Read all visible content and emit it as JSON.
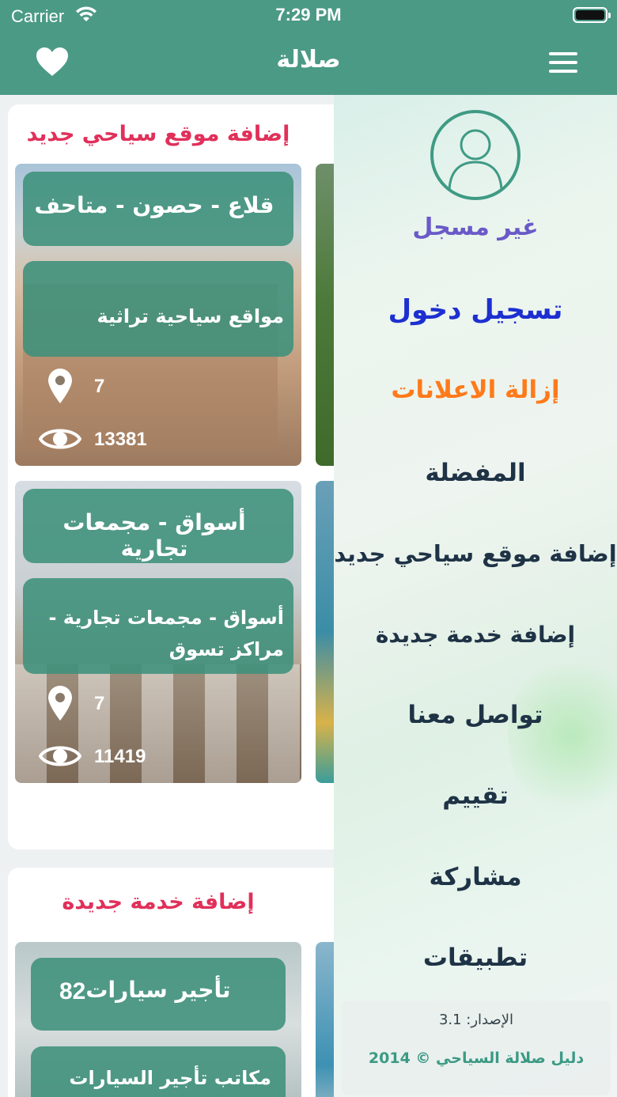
{
  "status_bar": {
    "carrier": "Carrier",
    "time": "7:29 PM"
  },
  "nav": {
    "title": "صلالة",
    "favorites_icon": "heart-icon",
    "menu_icon": "hamburger-menu-icon"
  },
  "sections": [
    {
      "title": "إضافة موقع سياحي جديد",
      "cards": [
        {
          "title": "قلاع - حصون - متاحف",
          "description": "مواقع سياحية تراثية",
          "location_count": "7",
          "views": "13381"
        },
        {
          "title": "أسواق - مجمعات تجارية",
          "description": "أسواق - مجمعات تجارية - مراكز تسوق",
          "location_count": "7",
          "views": "11419"
        }
      ]
    },
    {
      "title": "إضافة خدمة جديدة",
      "cards": [
        {
          "title": "تأجير سيارات",
          "count": "82",
          "description": "مكاتب تأجير السيارات أو"
        }
      ]
    }
  ],
  "drawer": {
    "user_status": "غير مسجل",
    "items": [
      {
        "label": "تسجيل دخول"
      },
      {
        "label": "إزالة الاعلانات"
      },
      {
        "label": "المفضلة"
      },
      {
        "label": "إضافة موقع سياحي جديد"
      },
      {
        "label": "إضافة خدمة جديدة"
      },
      {
        "label": "تواصل معنا"
      },
      {
        "label": "تقييم"
      },
      {
        "label": "مشاركة"
      },
      {
        "label": "تطبيقات"
      }
    ],
    "version": "الإصدار: 3.1",
    "copyright": "دليل صلالة السياحي © 2014"
  },
  "colors": {
    "primary": "#4b9a86",
    "accent_red": "#e0305a",
    "login_blue": "#1d2fd0",
    "ads_orange": "#ff7a1a"
  }
}
